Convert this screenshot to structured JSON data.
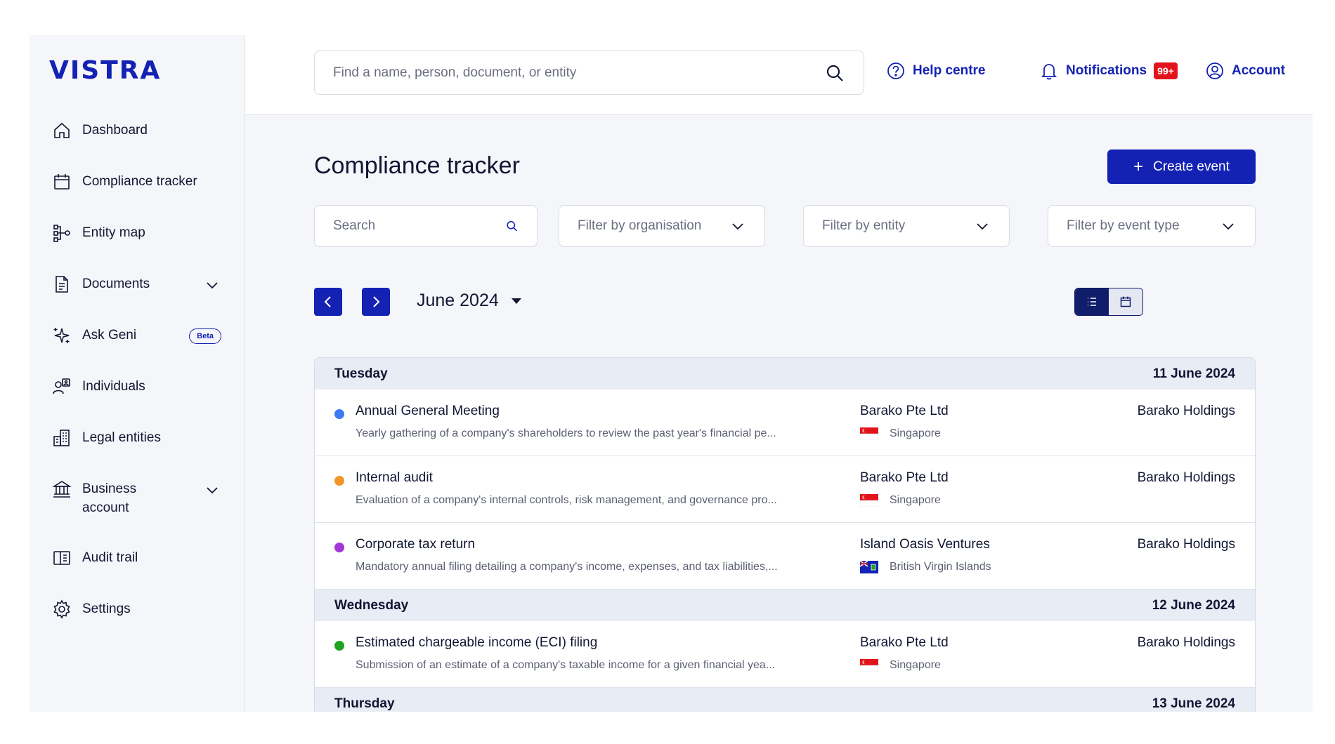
{
  "brand": {
    "logo": "VISTRA",
    "accent": "#1422b4"
  },
  "sidebar": {
    "items": [
      {
        "label": "Dashboard",
        "icon": "home-icon"
      },
      {
        "label": "Compliance tracker",
        "icon": "calendar-icon"
      },
      {
        "label": "Entity map",
        "icon": "entity-map-icon"
      },
      {
        "label": "Documents",
        "icon": "document-icon"
      },
      {
        "label": "Ask Geni",
        "icon": "sparkle-icon",
        "badge": "Beta"
      },
      {
        "label": "Individuals",
        "icon": "individuals-icon"
      },
      {
        "label": "Legal entities",
        "icon": "building-icon"
      },
      {
        "label": "Business account",
        "icon": "bank-icon"
      },
      {
        "label": "Audit trail",
        "icon": "audit-icon"
      },
      {
        "label": "Settings",
        "icon": "gear-icon"
      }
    ]
  },
  "header": {
    "search_placeholder": "Find a name, person, document, or entity",
    "help": "Help centre",
    "notifications": "Notifications",
    "notifications_count": "99+",
    "account": "Account"
  },
  "main": {
    "title": "Compliance tracker",
    "create_button": "Create event",
    "search_placeholder": "Search",
    "filter_org": "Filter by organisation",
    "filter_entity": "Filter by entity",
    "filter_event_type": "Filter by event type",
    "month": "June 2024"
  },
  "events": {
    "days": [
      {
        "day": "Tuesday",
        "date": "11 June 2024",
        "items": [
          {
            "title": "Annual General Meeting",
            "desc": "Yearly gathering of a company's shareholders to review the past year's financial pe...",
            "entity": "Barako Pte Ltd",
            "country": "Singapore",
            "org": "Barako Holdings",
            "color": "#3b7af0"
          },
          {
            "title": "Internal audit",
            "desc": "Evaluation of a company's internal controls, risk management, and governance pro...",
            "entity": "Barako Pte Ltd",
            "country": "Singapore",
            "org": "Barako Holdings",
            "color": "#f0962a"
          },
          {
            "title": "Corporate tax return",
            "desc": "Mandatory annual filing detailing a company's income, expenses, and tax liabilities,...",
            "entity": "Island Oasis Ventures",
            "country": "British Virgin Islands",
            "org": "Barako Holdings",
            "color": "#a536d8"
          }
        ]
      },
      {
        "day": "Wednesday",
        "date": "12 June 2024",
        "items": [
          {
            "title": "Estimated chargeable income (ECI) filing",
            "desc": "Submission of an estimate of a company's taxable income for a given financial yea...",
            "entity": "Barako Pte Ltd",
            "country": "Singapore",
            "org": "Barako Holdings",
            "color": "#1fa31f"
          }
        ]
      },
      {
        "day": "Thursday",
        "date": "13 June 2024",
        "items": []
      }
    ]
  }
}
